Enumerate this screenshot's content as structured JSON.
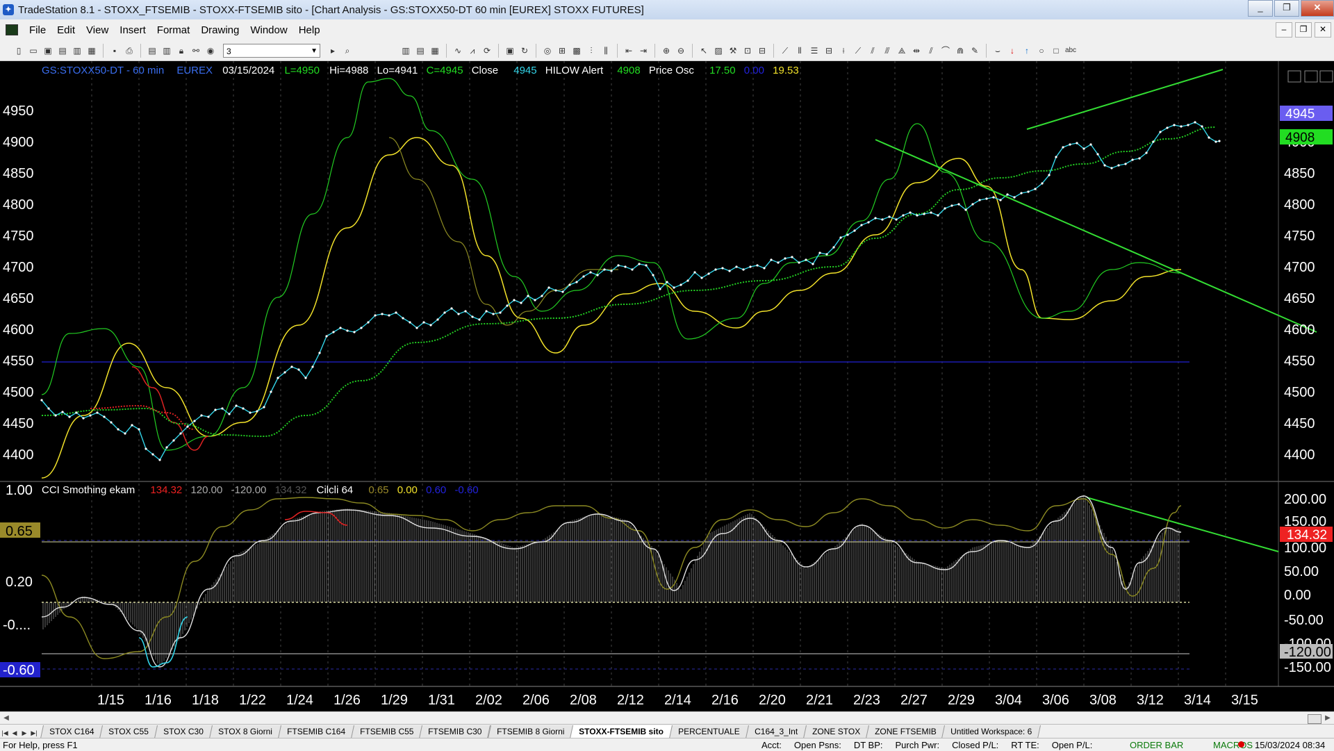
{
  "window": {
    "title": "TradeStation 8.1 - STOXX_FTSEMIB - STOXX-FTSEMIB sito - [Chart Analysis - GS:STOXX50-DT  60 min  [EUREX] STOXX FUTURES]",
    "controls": [
      "_",
      "❐",
      "✕"
    ]
  },
  "menu": {
    "items": [
      "File",
      "Edit",
      "View",
      "Insert",
      "Format",
      "Drawing",
      "Window",
      "Help"
    ],
    "mdi_controls": [
      "–",
      "❐",
      "✕"
    ]
  },
  "toolbar": {
    "combo_value": "3"
  },
  "chart": {
    "header": {
      "symbol": "GS:STOXX50-DT - 60 min",
      "exchange": "EUREX",
      "date": "03/15/2024",
      "low_label": "L=4950",
      "hi_label": "Hi=4988",
      "lo_label": "Lo=4941",
      "close_label": "C=4945",
      "close_word": "Close",
      "close_value": "4945",
      "hilow_label": "HILOW Alert",
      "hilow_value": "4908",
      "osc_label": "Price Osc",
      "osc_v1": "17.50",
      "osc_v2": "0.00",
      "osc_v3": "19.53"
    },
    "lower_header": {
      "cci_label": "CCI Smothing ekam",
      "cci_value": "134.32",
      "cci_high": "120.00",
      "cci_low": "-120.00",
      "cci_dim": "134.32",
      "cicli_label": "Cilcli 64",
      "cicli_v1": "0.65",
      "cicli_v2": "0.00",
      "cicli_v3": "0.60",
      "cicli_v4": "-0.60"
    },
    "price_axis_labels": [
      "4950",
      "4900",
      "4850",
      "4800",
      "4750",
      "4700",
      "4650",
      "4600",
      "4550",
      "4500",
      "4450",
      "4400"
    ],
    "price_badges": {
      "close": "4945",
      "hilow": "4908"
    },
    "lower_left_labels": [
      "1.00",
      "0.65",
      "0.20",
      "-0....",
      "-0.60"
    ],
    "lower_right_labels": [
      "200.00",
      "150.00",
      "100.00",
      "50.00",
      "0.00",
      "-50.00",
      "-100.00",
      "-120.00",
      "-150.00"
    ],
    "lower_right_badge": "134.32",
    "date_labels": [
      "1/15",
      "1/16",
      "1/18",
      "1/22",
      "1/24",
      "1/26",
      "1/29",
      "1/31",
      "2/02",
      "2/06",
      "2/08",
      "2/12",
      "2/14",
      "2/16",
      "2/20",
      "2/21",
      "2/23",
      "2/27",
      "2/29",
      "3/04",
      "3/06",
      "3/08",
      "3/12",
      "3/14",
      "3/15"
    ],
    "colors": {
      "price": "#33d6ea",
      "price_dots": "#ffffff",
      "ma_green": "#22cc22",
      "osc_green": "#22cc22",
      "osc_yellow": "#f2e22a",
      "trend": "#33dd33",
      "red_segment": "#dd2222",
      "level_blue": "#1b1bb0",
      "badge_close": "#6a5df0",
      "badge_hilow": "#22dd22",
      "badge_cci": "#ee2222",
      "badge_065": "#9a8a2a",
      "badge_060": "#2222cc"
    }
  },
  "workspace_tabs": [
    "STOX C164",
    "STOX C55",
    "STOX  C30",
    "STOX  8 Giorni",
    "FTSEMIB C164",
    "FTSEMIB C55",
    "FTSEMIB C30",
    "FTSEMIB  8 Giorni",
    "STOXX-FTSEMIB sito",
    "PERCENTUALE",
    "C164_3_Int",
    "ZONE STOX",
    "ZONE FTSEMIB",
    "Untitled Workspace:  6"
  ],
  "active_tab": "STOXX-FTSEMIB sito",
  "status": {
    "help": "For Help, press F1",
    "fields": [
      "Acct:",
      "Open Psns:",
      "DT BP:",
      "Purch Pwr:",
      "Closed P/L:",
      "RT TE:",
      "Open P/L:"
    ],
    "order_bar": "ORDER BAR",
    "macros": "MACROS",
    "datetime": "15/03/2024 08:34"
  }
}
